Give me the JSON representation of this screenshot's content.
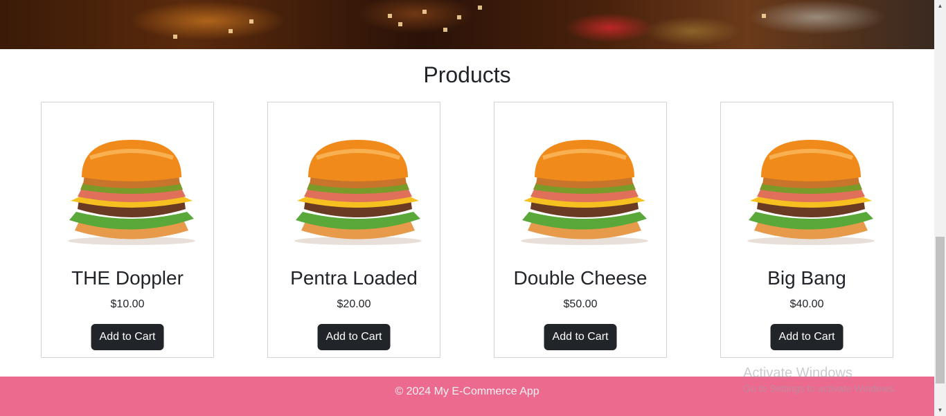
{
  "header": {
    "title": "Products"
  },
  "products": [
    {
      "name": "THE Doppler",
      "price": "$10.00",
      "button_label": "Add to Cart"
    },
    {
      "name": "Pentra Loaded",
      "price": "$20.00",
      "button_label": "Add to Cart"
    },
    {
      "name": "Double Cheese",
      "price": "$50.00",
      "button_label": "Add to Cart"
    },
    {
      "name": "Big Bang",
      "price": "$40.00",
      "button_label": "Add to Cart"
    }
  ],
  "footer": {
    "text": "© 2024 My E-Commerce App"
  },
  "watermark": {
    "title": "Activate Windows",
    "subtitle": "Go to Settings to activate Windows."
  },
  "colors": {
    "footer_bg": "#eb6a8e",
    "button_bg": "#212529"
  },
  "icons": {
    "product_image": "burger-image"
  }
}
